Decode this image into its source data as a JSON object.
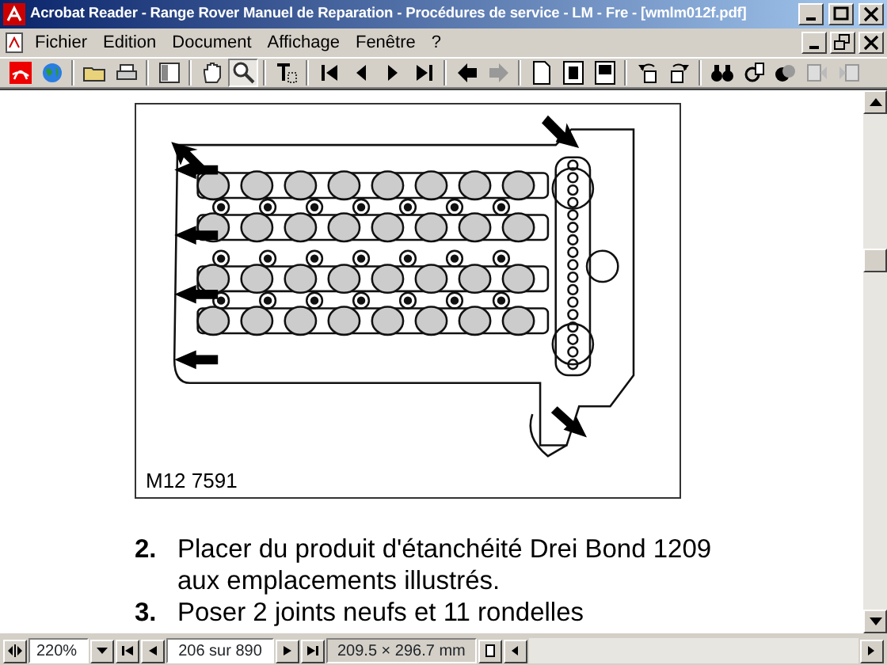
{
  "window": {
    "title": "Acrobat Reader - Range Rover Manuel de Reparation - Procédures de service - LM - Fre - [wmlm012f.pdf]"
  },
  "menu": [
    {
      "label": "Fichier"
    },
    {
      "label": "Edition"
    },
    {
      "label": "Document"
    },
    {
      "label": "Affichage"
    },
    {
      "label": "Fenêtre"
    },
    {
      "label": "?"
    }
  ],
  "document": {
    "figure": {
      "caption": "M12 7591"
    },
    "steps": [
      {
        "number": "2.",
        "text": "Placer du produit d'étanchéité Drei Bond 1209 aux emplacements illustrés."
      },
      {
        "number": "3.",
        "text": "Poser 2 joints neufs et 11 rondelles"
      }
    ]
  },
  "status_bar": {
    "zoom": "220%",
    "page": "206 sur 890",
    "page_size": "209.5 × 296.7 mm"
  }
}
